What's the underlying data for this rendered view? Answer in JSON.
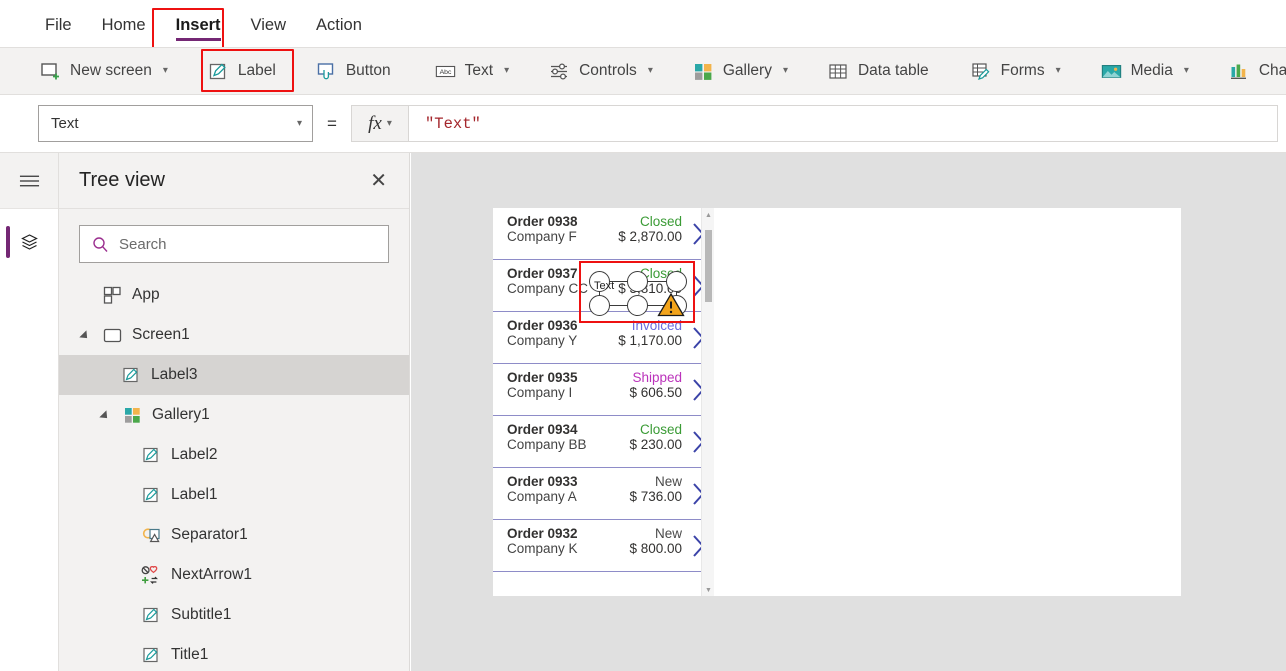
{
  "menubar": {
    "items": [
      {
        "label": "File",
        "active": false
      },
      {
        "label": "Home",
        "active": false
      },
      {
        "label": "Insert",
        "active": true
      },
      {
        "label": "View",
        "active": false
      },
      {
        "label": "Action",
        "active": false
      }
    ]
  },
  "ribbon": {
    "items": [
      {
        "label": "New screen",
        "icon": "new-screen-icon",
        "caret": true
      },
      {
        "label": "Label",
        "icon": "label-icon",
        "caret": false,
        "highlighted": true
      },
      {
        "label": "Button",
        "icon": "button-icon",
        "caret": false
      },
      {
        "label": "Text",
        "icon": "text-icon",
        "caret": true
      },
      {
        "label": "Controls",
        "icon": "controls-icon",
        "caret": true
      },
      {
        "label": "Gallery",
        "icon": "gallery-icon",
        "caret": true
      },
      {
        "label": "Data table",
        "icon": "data-table-icon",
        "caret": false
      },
      {
        "label": "Forms",
        "icon": "forms-icon",
        "caret": true
      },
      {
        "label": "Media",
        "icon": "media-icon",
        "caret": true
      },
      {
        "label": "Char",
        "icon": "charts-icon",
        "caret": false
      }
    ]
  },
  "formula_bar": {
    "property": "Text",
    "equals": "=",
    "fx_label": "fx",
    "formula": "\"Text\""
  },
  "rail": {
    "menu_icon": "hamburger-menu-icon",
    "items": [
      {
        "icon": "tree-view-layers-icon",
        "active": true
      }
    ]
  },
  "tree_panel": {
    "title": "Tree view",
    "close_label": "✕",
    "search": {
      "placeholder": "Search",
      "value": "",
      "icon": "search-icon"
    },
    "items": [
      {
        "label": "App",
        "icon": "app-icon",
        "indent": 0,
        "twisty": "none",
        "selected": false
      },
      {
        "label": "Screen1",
        "icon": "screen-icon",
        "indent": 0,
        "twisty": "open",
        "selected": false
      },
      {
        "label": "Label3",
        "icon": "label-control-icon",
        "indent": 1,
        "twisty": "none",
        "selected": true
      },
      {
        "label": "Gallery1",
        "icon": "gallery-control-icon",
        "indent": 1,
        "twisty": "open",
        "selected": false
      },
      {
        "label": "Label2",
        "icon": "label-control-icon",
        "indent": 2,
        "twisty": "none",
        "selected": false
      },
      {
        "label": "Label1",
        "icon": "label-control-icon",
        "indent": 2,
        "twisty": "none",
        "selected": false
      },
      {
        "label": "Separator1",
        "icon": "separator-control-icon",
        "indent": 2,
        "twisty": "none",
        "selected": false
      },
      {
        "label": "NextArrow1",
        "icon": "next-arrow-control-icon",
        "indent": 2,
        "twisty": "none",
        "selected": false
      },
      {
        "label": "Subtitle1",
        "icon": "label-control-icon",
        "indent": 2,
        "twisty": "none",
        "selected": false
      },
      {
        "label": "Title1",
        "icon": "label-control-icon",
        "indent": 2,
        "twisty": "none",
        "selected": false
      }
    ]
  },
  "canvas": {
    "selected_control": {
      "name": "Label3",
      "text": "Text",
      "warning_icon": "warning-triangle-icon"
    },
    "gallery": {
      "scrollbar": {
        "up": "▲",
        "down": "▼"
      },
      "rows": [
        {
          "order": "Order 0938",
          "company": "Company F",
          "status": "Closed",
          "status_color": "#3a9b35",
          "amount": "$ 2,870.00"
        },
        {
          "order": "Order 0937",
          "company": "Company CC",
          "status": "Closed",
          "status_color": "#3a9b35",
          "amount": "$ 3,810.00"
        },
        {
          "order": "Order 0936",
          "company": "Company Y",
          "status": "Invoiced",
          "status_color": "#6b6bdd",
          "amount": "$ 1,170.00"
        },
        {
          "order": "Order 0935",
          "company": "Company I",
          "status": "Shipped",
          "status_color": "#bb33bb",
          "amount": "$ 606.50"
        },
        {
          "order": "Order 0934",
          "company": "Company BB",
          "status": "Closed",
          "status_color": "#3a9b35",
          "amount": "$ 230.00"
        },
        {
          "order": "Order 0933",
          "company": "Company A",
          "status": "New",
          "status_color": "#4a4a4a",
          "amount": "$ 736.00"
        },
        {
          "order": "Order 0932",
          "company": "Company K",
          "status": "New",
          "status_color": "#4a4a4a",
          "amount": "$ 800.00"
        }
      ]
    }
  },
  "colors": {
    "accent_purple": "#742774",
    "highlight_red": "#ee1111",
    "ribbon_bg": "#f3f2f1",
    "canvas_bg": "#e0e0e0",
    "formula_text": "#a4262c"
  }
}
